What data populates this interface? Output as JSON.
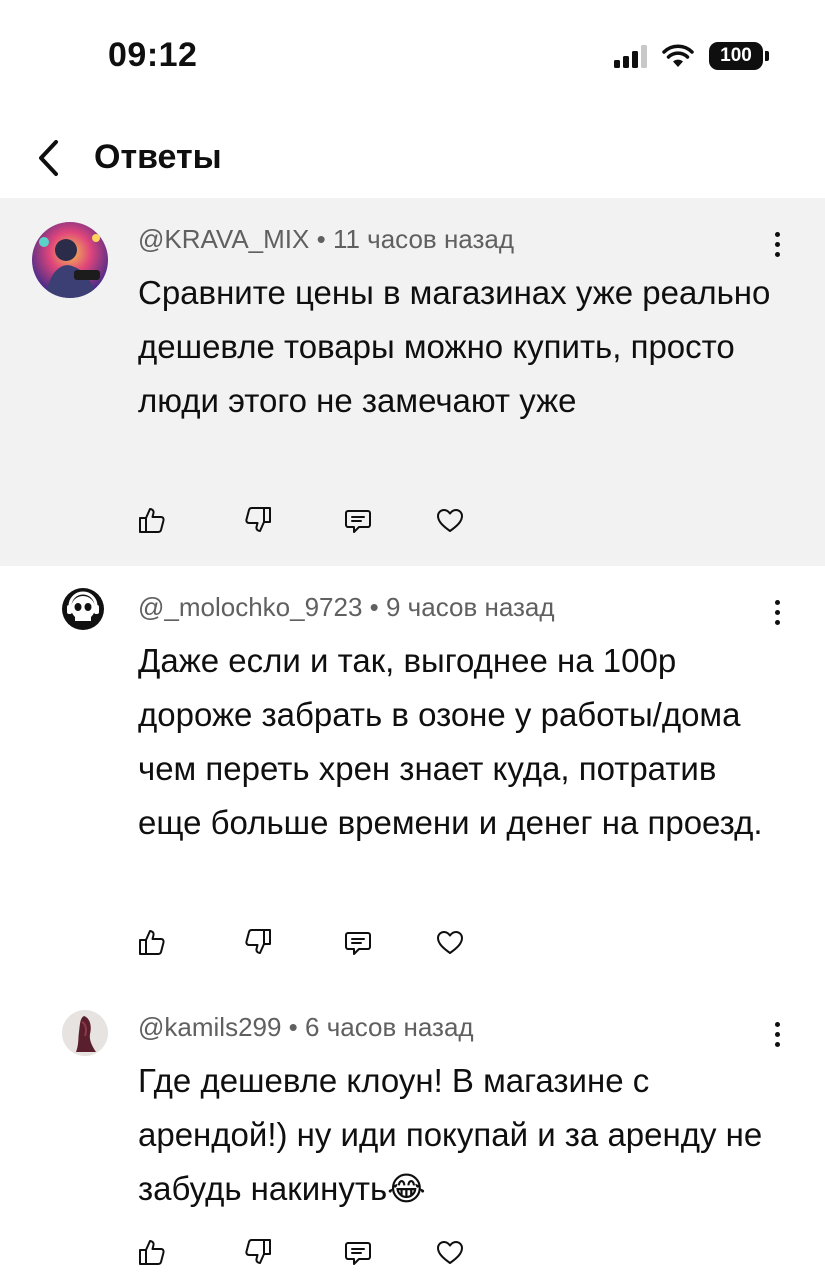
{
  "status_bar": {
    "time": "09:12",
    "battery": "100",
    "icons": [
      "signal-icon",
      "wifi-icon",
      "battery-icon"
    ]
  },
  "header": {
    "title": "Ответы",
    "back_icon": "chevron-left-icon"
  },
  "comments": [
    {
      "author": "@KRAVA_MIX",
      "time": "11 часов назад",
      "text": "Сравните цены в магазинах уже реально дешевле товары можно купить, просто люди этого не замечают уже",
      "highlighted": true
    },
    {
      "author": "@_molochko_9723",
      "time": "9 часов назад",
      "text": "Даже если и так, выгоднее на 100р дороже забрать в озоне у работы/дома чем переть хрен знает куда, потратив еще больше времени и денег на проезд.",
      "highlighted": false
    },
    {
      "author": "@kamils299",
      "time": "6 часов назад",
      "text": "Где дешевле клоун! В магазине с арендой!) ну иди покупай и за аренду не забудь накинуть😂",
      "highlighted": false
    }
  ],
  "meta_separator": " • ",
  "action_icons": [
    "thumbs-up-icon",
    "thumbs-down-icon",
    "reply-icon",
    "heart-icon"
  ],
  "colors": {
    "highlight_bg": "#f2f2f2",
    "meta_text": "#606060",
    "text": "#0f0f0f"
  }
}
